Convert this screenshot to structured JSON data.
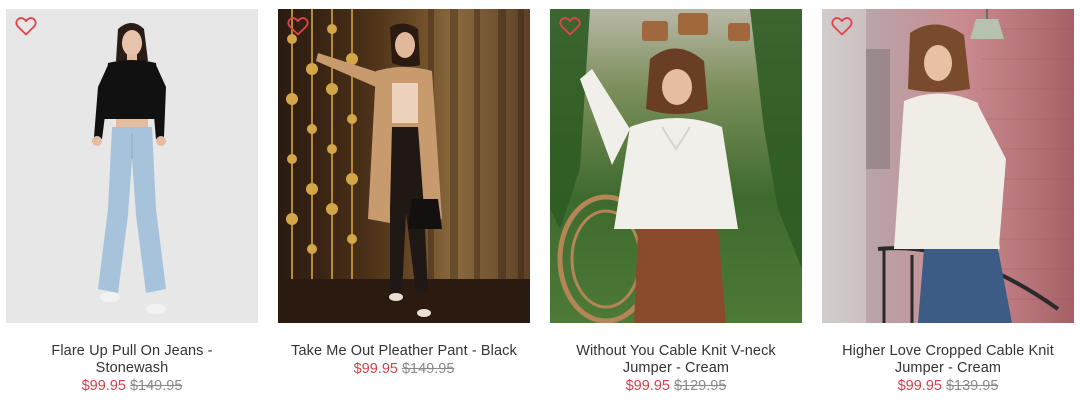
{
  "products": [
    {
      "title": "Flare Up Pull On Jeans -",
      "title2": "Stonewash",
      "price": "$99.95",
      "compare_price": "$149.95"
    },
    {
      "title": "Take Me Out Pleather Pant - Black",
      "title2": "",
      "price": "$99.95",
      "compare_price": "$149.95"
    },
    {
      "title": "Without You Cable Knit V-neck",
      "title2": "Jumper - Cream",
      "price": "$99.95",
      "compare_price": "$129.95"
    },
    {
      "title": "Higher Love Cropped Cable Knit",
      "title2": "Jumper - Cream",
      "price": "$99.95",
      "compare_price": "$139.95"
    }
  ],
  "colors": {
    "sale_price": "#d0424c",
    "compare_price": "#8a8a8a",
    "title": "#333333",
    "wishlist_heart": "#e0444c"
  },
  "icons": {
    "wishlist": "heart-outline-icon"
  }
}
